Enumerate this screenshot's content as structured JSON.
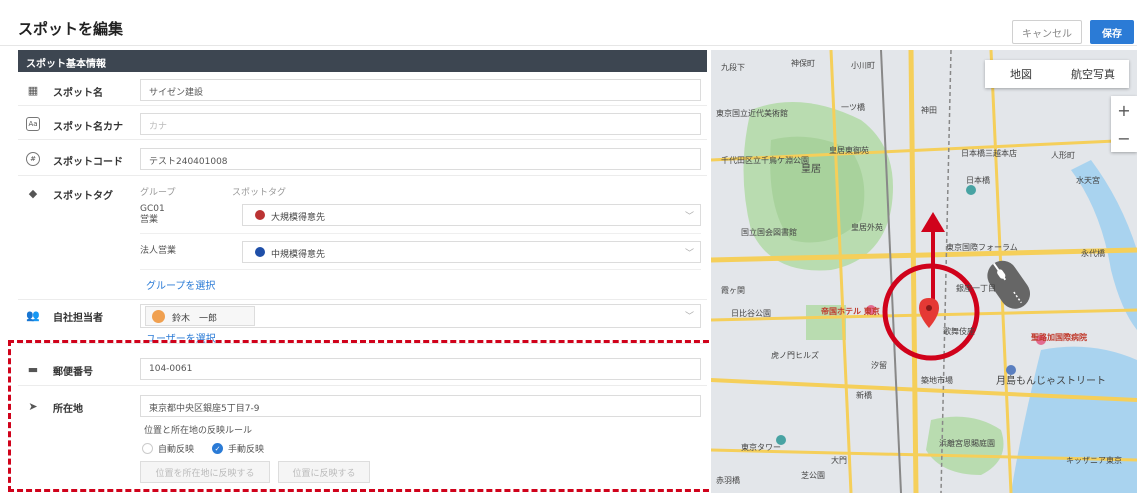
{
  "header": {
    "title": "スポットを編集",
    "cancel_label": "キャンセル",
    "save_label": "保存"
  },
  "section": {
    "title": "スポット基本情報"
  },
  "fields": {
    "spot_name": {
      "label": "スポット名",
      "value": "サイゼン建設"
    },
    "spot_kana": {
      "label": "スポット名カナ",
      "placeholder": "カナ"
    },
    "spot_code": {
      "label": "スポットコード",
      "value": "テスト240401008"
    },
    "spot_tag": {
      "label": "スポットタグ",
      "col_group": "グループ",
      "col_tag": "スポットタグ",
      "rows": [
        {
          "group_line1": "GC01",
          "group_line2": "営業",
          "tag": "大規模得意先"
        },
        {
          "group_line1": "法人営業",
          "group_line2": "",
          "tag": "中規模得意先"
        }
      ],
      "select_group_link": "グループを選択"
    },
    "owner": {
      "label": "自社担当者",
      "user_name": "鈴木　一郎",
      "select_user_link": "ユーザーを選択"
    },
    "postal": {
      "label": "郵便番号",
      "value": "104-0061"
    },
    "address": {
      "label": "所在地",
      "value": "東京都中央区銀座5丁目7-9",
      "rule_label": "位置と所在地の反映ルール",
      "option_auto": "自動反映",
      "option_manual": "手動反映",
      "btn_pos_to_addr": "位置を所在地に反映する",
      "btn_addr_to_pos": "位置に反映する"
    }
  },
  "map": {
    "type_map": "地図",
    "type_aerial": "航空写真",
    "zoom_in": "+",
    "zoom_out": "−",
    "labels": [
      "九段下",
      "神保町",
      "小川町",
      "東京国立近代美術館",
      "一ツ橋",
      "神田",
      "千代田区立千鳥ケ淵公園",
      "皇居",
      "皇居東御苑",
      "日本橋三越本店",
      "人形町",
      "日本橋",
      "水天宮",
      "国立国会図書館",
      "皇居外苑",
      "東京国際フォーラム",
      "永代橋",
      "霞ヶ関",
      "日比谷公園",
      "帝国ホテル 東京",
      "銀座一丁目",
      "歌舞伎座",
      "月島もんじゃストリート",
      "虎ノ門ヒルズ",
      "汐留",
      "浜離宮恩賜庭園",
      "聖路加国際病院",
      "築地市場",
      "芝公園",
      "東京タワー",
      "キッザニア東京",
      "大門",
      "赤羽橋",
      "新橋"
    ]
  }
}
